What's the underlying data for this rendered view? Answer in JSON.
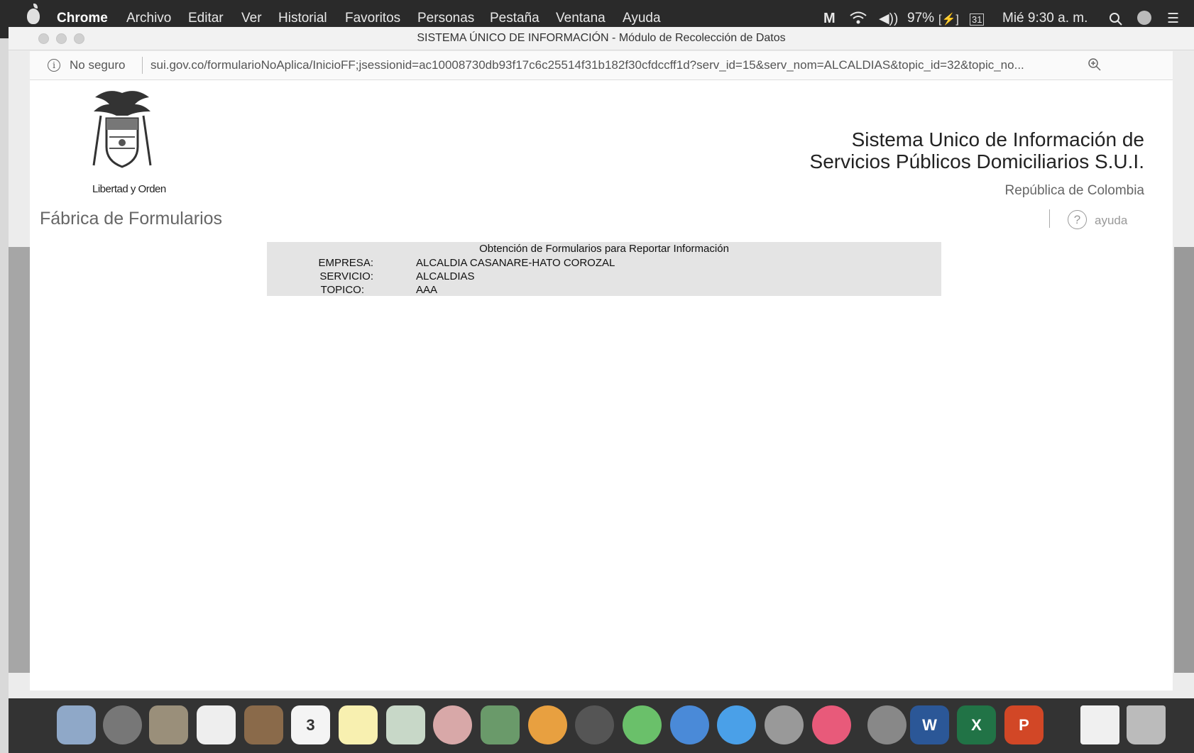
{
  "menubar": {
    "app": "Chrome",
    "items": [
      "Archivo",
      "Editar",
      "Ver",
      "Historial",
      "Favoritos",
      "Personas",
      "Pestaña",
      "Ventana",
      "Ayuda"
    ],
    "battery": "97%",
    "clock": "Mié 9:30 a. m."
  },
  "window": {
    "title": "SISTEMA ÚNICO DE INFORMACIÓN - Módulo de Recolección de Datos",
    "security": "No seguro",
    "url": "sui.gov.co/formularioNoAplica/InicioFF;jsessionid=ac10008730db93f17c6c25514f31b182f30cfdccff1d?serv_id=15&serv_nom=ALCALDIAS&topic_id=32&topic_no..."
  },
  "page": {
    "seal_caption": "Libertad y Orden",
    "fabrica": "Fábrica de Formularios",
    "sui_line1": "Sistema Unico de Información de",
    "sui_line2": "Servicios Públicos Domiciliarios S.U.I.",
    "republica": "República de Colombia",
    "help": "ayuda",
    "form": {
      "title": "Obtención de Formularios para Reportar Información",
      "empresa_label": "EMPRESA:",
      "empresa_value": "ALCALDIA CASANARE-HATO COROZAL",
      "servicio_label": "SERVICIO:",
      "servicio_value": "ALCALDIAS",
      "topico_label": "TOPICO:",
      "topico_value": "AAA"
    }
  },
  "dock": {
    "calendar_day": "3",
    "word": "W",
    "excel": "X",
    "powerpoint": "P"
  },
  "colors": {
    "menubar": "#2a2a2a",
    "form_box": "#e4e4e4",
    "page_bg": "#ffffff"
  }
}
